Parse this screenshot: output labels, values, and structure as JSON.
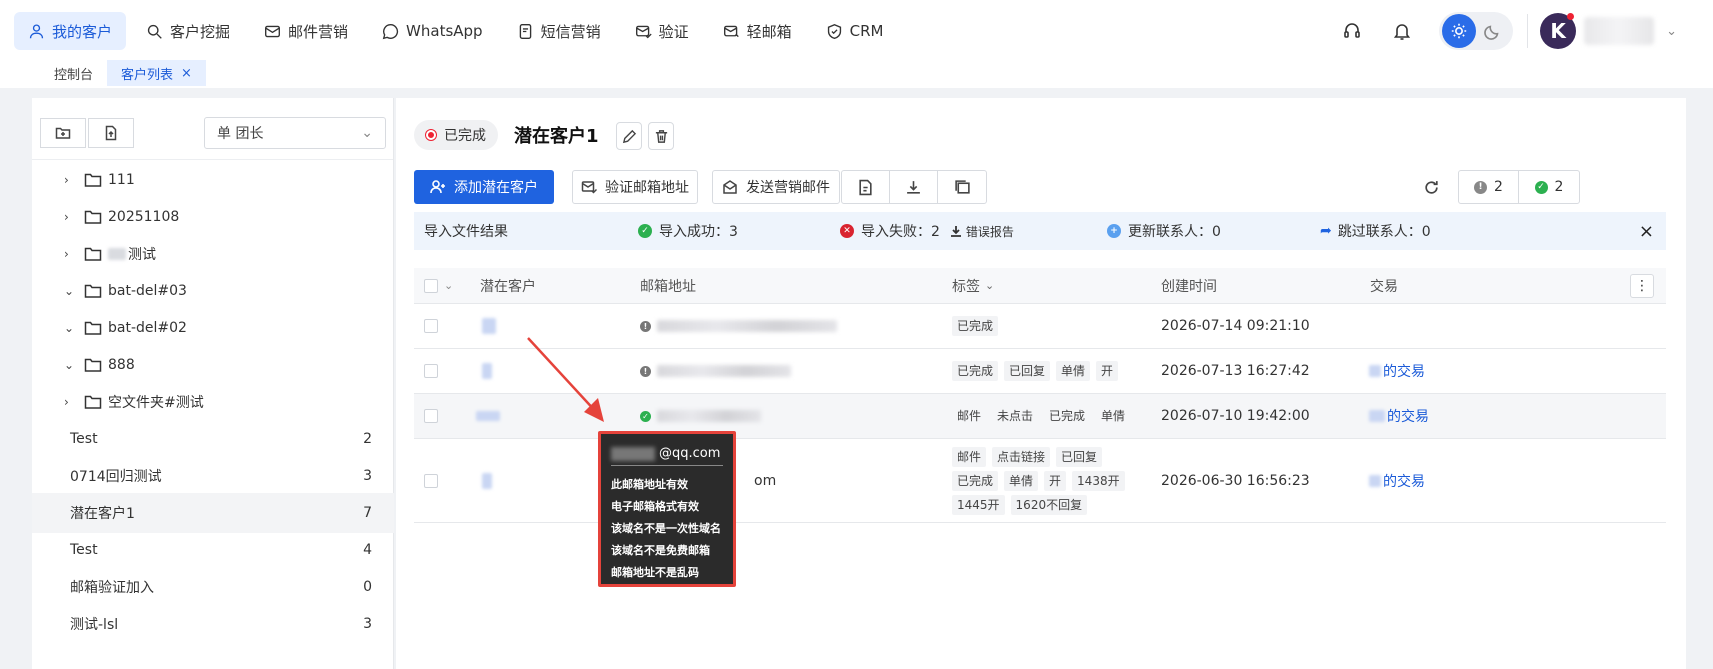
{
  "nav": {
    "items": [
      {
        "label": "我的客户",
        "icon": "user-icon",
        "active": true
      },
      {
        "label": "客户挖掘",
        "icon": "search-icon",
        "active": false
      },
      {
        "label": "邮件营销",
        "icon": "mail-icon",
        "active": false
      },
      {
        "label": "WhatsApp",
        "icon": "whatsapp-icon",
        "active": false
      },
      {
        "label": "短信营销",
        "icon": "sms-icon",
        "active": false
      },
      {
        "label": "验证",
        "icon": "mail-check-icon",
        "active": false
      },
      {
        "label": "轻邮箱",
        "icon": "mail-light-icon",
        "active": false
      },
      {
        "label": "CRM",
        "icon": "shield-icon",
        "active": false
      }
    ]
  },
  "tabs": {
    "dashboard": "控制台",
    "customer_list": "客户列表",
    "close": "×"
  },
  "user": {
    "avatar_letter": "K"
  },
  "sidebar": {
    "select_value": "单 团长",
    "folders": [
      {
        "label": "111",
        "expanded": false
      },
      {
        "label": "20251108",
        "expanded": false
      },
      {
        "label": "测试",
        "expanded": false,
        "blurred_prefix": true
      },
      {
        "label": "bat-del#03",
        "expanded": true
      },
      {
        "label": "bat-del#02",
        "expanded": true
      },
      {
        "label": "888",
        "expanded": true
      },
      {
        "label": "空文件夹#测试",
        "expanded": false
      }
    ],
    "groups": [
      {
        "label": "Test",
        "count": "2"
      },
      {
        "label": "0714回归测试",
        "count": "3"
      },
      {
        "label": "潜在客户1",
        "count": "7",
        "active": true
      },
      {
        "label": "Test",
        "count": "4"
      },
      {
        "label": "邮箱验证加入",
        "count": "0"
      },
      {
        "label": "测试-lsl",
        "count": "3"
      }
    ]
  },
  "main": {
    "status": "已完成",
    "title": "潜在客户1",
    "buttons": {
      "add": "添加潜在客户",
      "verify": "验证邮箱地址",
      "send": "发送营销邮件"
    },
    "counts": {
      "warn": "2",
      "ok": "2"
    },
    "import_bar": {
      "title": "导入文件结果",
      "success": "导入成功：3",
      "fail": "导入失败：2",
      "error_report": "错误报告",
      "updated": "更新联系人：0",
      "skipped": "跳过联系人：0",
      "close": "×"
    },
    "table": {
      "headers": {
        "customer": "潜在客户",
        "email": "邮箱地址",
        "tags": "标签",
        "created": "创建时间",
        "deal": "交易"
      },
      "rows": [
        {
          "status": "unknown",
          "tags": [
            "已完成"
          ],
          "created": "2026-07-14 09:21:10",
          "deal": ""
        },
        {
          "status": "unknown",
          "tags": [
            "已完成",
            "已回复",
            "单倩",
            "开"
          ],
          "created": "2026-07-13 16:27:42",
          "deal": "的交易"
        },
        {
          "status": "valid",
          "tags": [
            "邮件",
            "未点击",
            "已完成",
            "单倩"
          ],
          "created": "2026-07-10 19:42:00",
          "deal": "的交易"
        },
        {
          "status": "none",
          "email_suffix": "om",
          "tags": [
            "邮件",
            "点击链接",
            "已回复",
            "已完成",
            "单倩",
            "开",
            "1438开",
            "1445开",
            "1620不回复"
          ],
          "created": "2026-06-30 16:56:23",
          "deal": "的交易"
        }
      ]
    }
  },
  "tooltip": {
    "email_domain": "@qq.com",
    "lines": [
      "此邮箱地址有效",
      "电子邮箱格式有效",
      "该域名不是一次性域名",
      "该域名不是免费邮箱",
      "邮箱地址不是乱码"
    ]
  },
  "colors": {
    "primary": "#1f63e0",
    "highlight": "#e5433b",
    "success": "#2cb050",
    "danger": "#d9232f"
  }
}
